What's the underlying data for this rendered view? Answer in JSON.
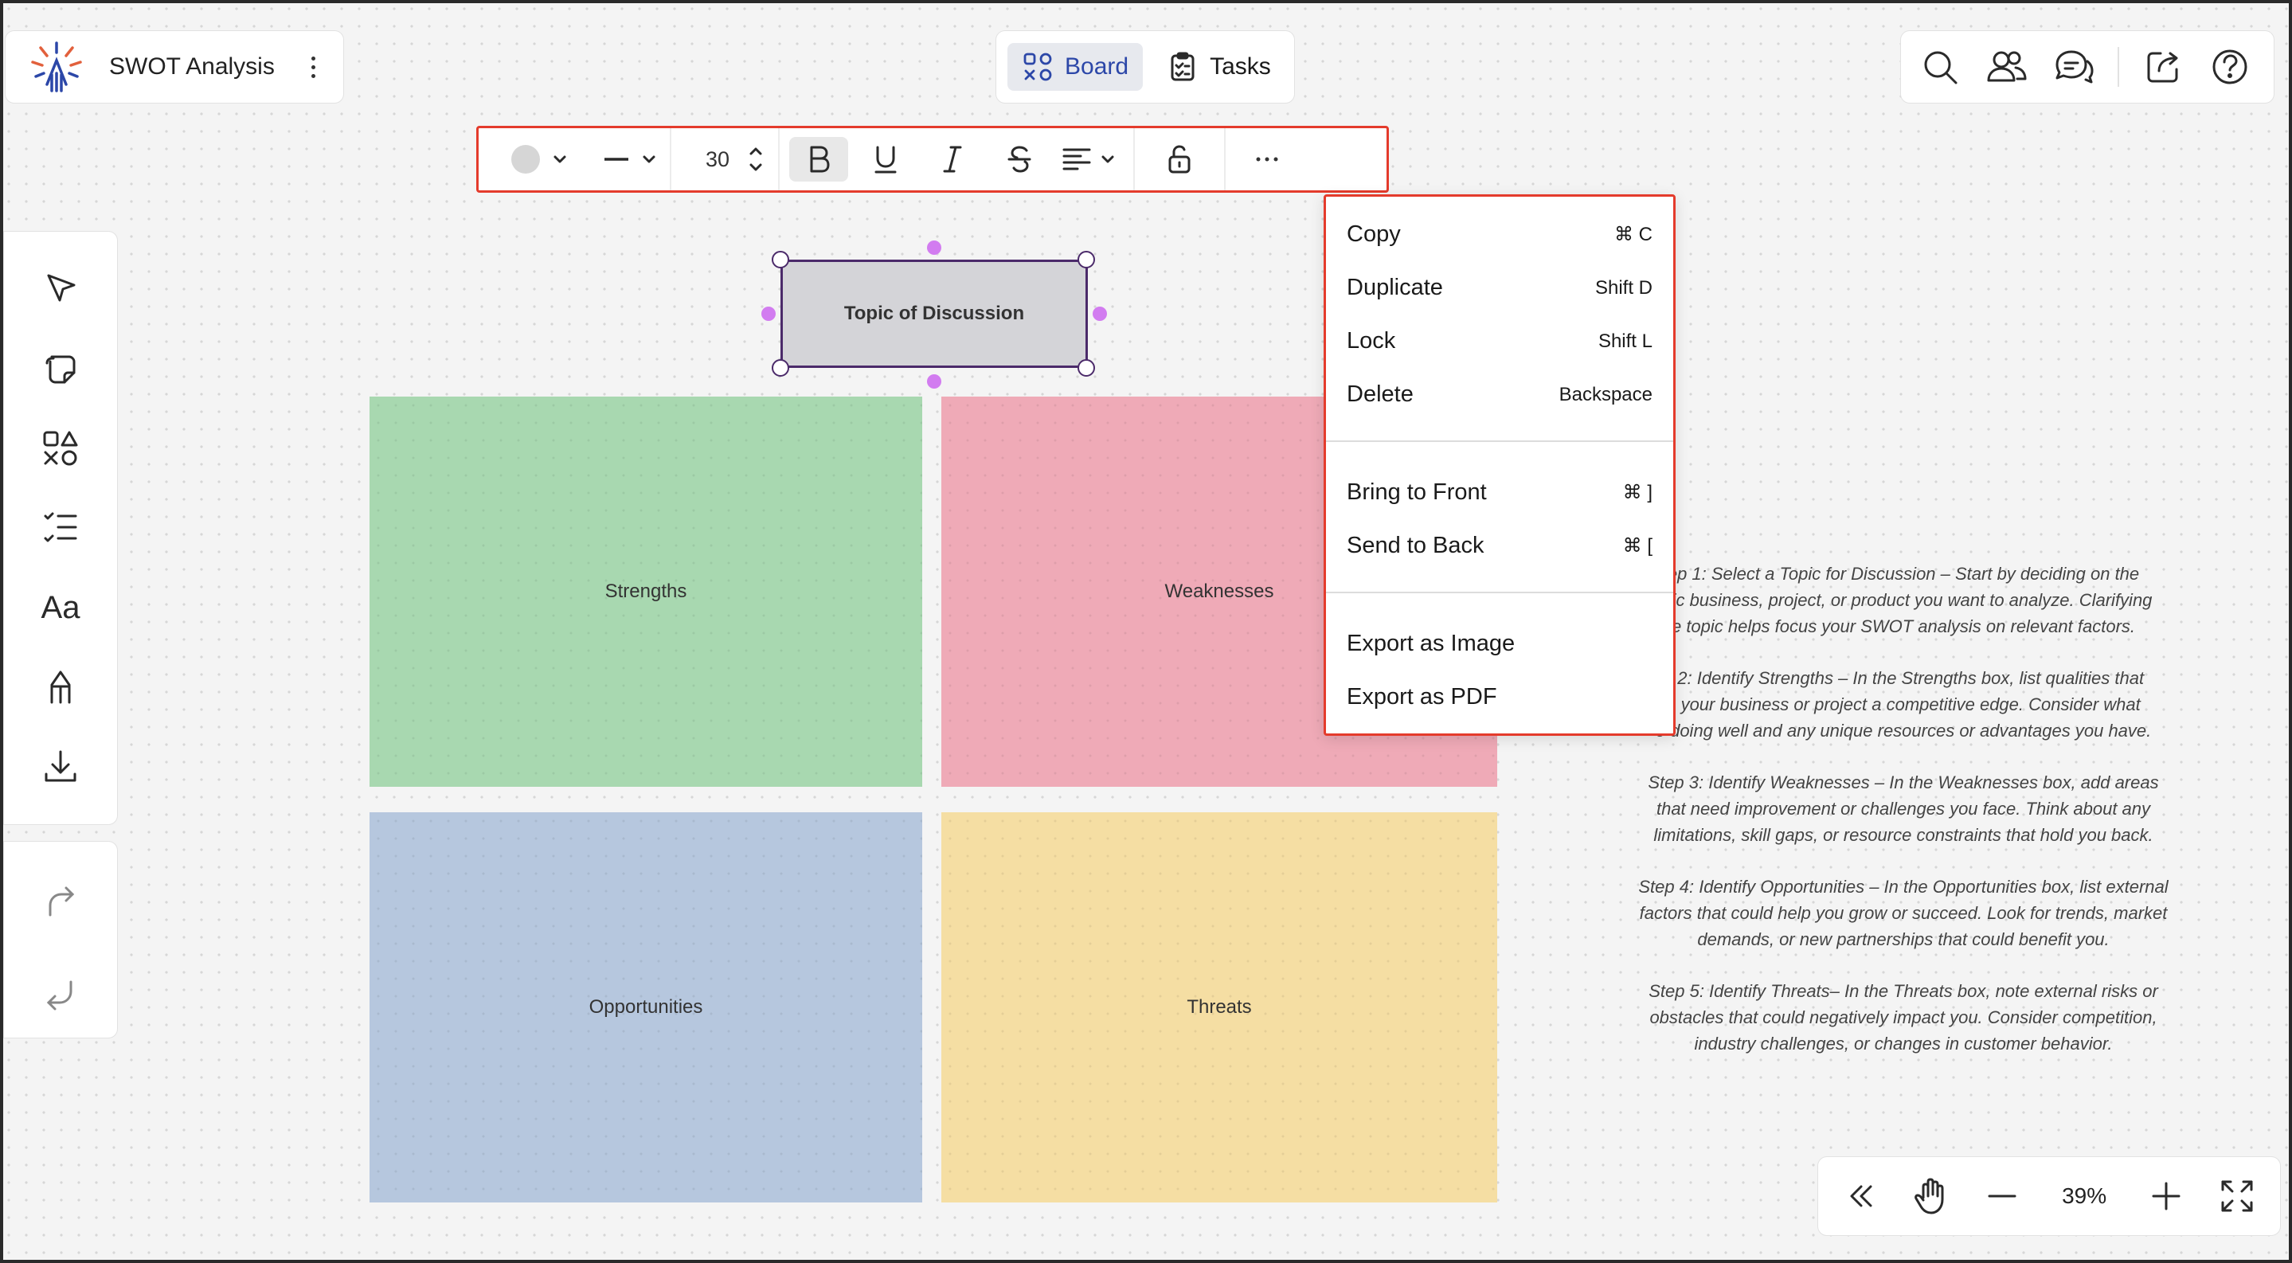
{
  "app": {
    "title": "SWOT Analysis",
    "logo_icon": "sparkle-logo-icon"
  },
  "view_switch": {
    "board_label": "Board",
    "tasks_label": "Tasks",
    "active": "Board"
  },
  "top_right_icons": [
    "search-icon",
    "users-icon",
    "comments-icon",
    "share-icon",
    "help-icon"
  ],
  "toolbar": {
    "fill_color": "#d6d6d6",
    "font_size": "30",
    "text_formats": [
      "bold",
      "underline",
      "italic",
      "strikethrough"
    ],
    "active_format": "bold"
  },
  "tools": [
    "select-icon",
    "sticky-note-icon",
    "shapes-icon",
    "checklist-icon",
    "text-icon",
    "pen-icon",
    "download-icon"
  ],
  "tools_text_label": "Aa",
  "canvas": {
    "topic": "Topic of Discussion",
    "strengths": "Strengths",
    "weaknesses": "Weaknesses",
    "opportunities": "Opportunities",
    "threats": "Threats",
    "colors": {
      "strengths": "#a8d8b0",
      "weaknesses": "#efaab7",
      "opportunities": "#b6c7de",
      "threats": "#f5dea3"
    }
  },
  "instructions": [
    {
      "lines": [
        "ep 1: Select a Topic for Discussion – Start by deciding on the",
        "cific business, project, or product you want to analyze. Clarifying",
        "e topic helps focus your SWOT analysis on relevant factors."
      ]
    },
    {
      "lines": [
        "p 2: Identify Strengths – In the Strengths box, list qualities that",
        "e your business or project a competitive edge. Consider what",
        "e doing well and any unique resources or advantages you have."
      ]
    },
    {
      "lines": [
        "Step 3: Identify Weaknesses – In the Weaknesses box, add areas",
        "that need improvement or challenges you face. Think about any",
        "limitations, skill gaps, or resource constraints that hold you back."
      ]
    },
    {
      "lines": [
        "Step 4: Identify Opportunities – In the Opportunities box, list external",
        "factors that could help you grow or succeed. Look for trends, market",
        "demands, or new partnerships that could benefit you."
      ]
    },
    {
      "lines": [
        "Step 5: Identify Threats– In the Threats box, note external risks or",
        "obstacles that could negatively impact you. Consider competition,",
        "industry challenges, or changes in customer behavior."
      ]
    }
  ],
  "context_menu": {
    "copy": {
      "label": "Copy",
      "shortcut": "⌘ C"
    },
    "duplicate": {
      "label": "Duplicate",
      "shortcut": "Shift D"
    },
    "lock": {
      "label": "Lock",
      "shortcut": "Shift L"
    },
    "delete": {
      "label": "Delete",
      "shortcut": "Backspace"
    },
    "bring_front": {
      "label": "Bring to Front",
      "shortcut": "⌘ ]"
    },
    "send_back": {
      "label": "Send to Back",
      "shortcut": "⌘ ["
    },
    "export_image": {
      "label": "Export as Image"
    },
    "export_pdf": {
      "label": "Export as PDF"
    }
  },
  "zoom": {
    "level": "39%"
  },
  "accent": "#e43b2c"
}
